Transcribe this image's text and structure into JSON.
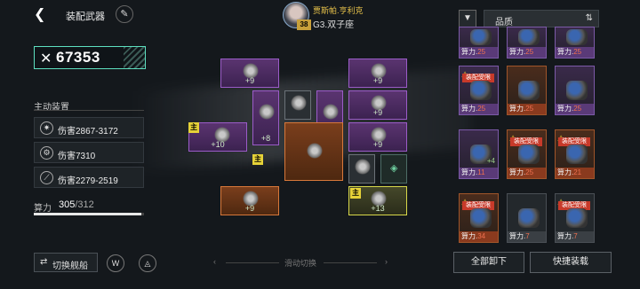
{
  "header": {
    "title": "装配武器",
    "pilot_name": "贾斯帕.亨利克",
    "pilot_ship": "G3.双子座",
    "pilot_level": "38"
  },
  "left": {
    "power_value": "67353",
    "active_equipment_label": "主动装置",
    "skills": [
      {
        "icon": "burst-icon",
        "text": "伤害2867-3172"
      },
      {
        "icon": "gear-burst-icon",
        "text": "伤害7310"
      },
      {
        "icon": "claw-icon",
        "text": "伤害2279-2519"
      }
    ],
    "capacity_label": "算力",
    "capacity_used": "305",
    "capacity_max": "/312",
    "capacity_fraction": 0.9776,
    "swap_ship_label": "切换舰船"
  },
  "swipe": {
    "label": "滑动切换"
  },
  "grid": {
    "slots": [
      {
        "label": "+9"
      },
      {
        "label": "+9"
      },
      {
        "label": "+9"
      },
      {
        "label": "+9"
      },
      {
        "label": "+10"
      },
      {
        "label": "+8"
      },
      {
        "label": "+9"
      },
      {
        "label": "+9"
      },
      {
        "label": "+9"
      },
      {
        "label": "+13"
      }
    ],
    "main_marker": "主"
  },
  "panel": {
    "sort_label": "品质",
    "power_prefix": "算力.",
    "lock_label": "装配受限",
    "cards": [
      {
        "power": "25",
        "plus": "",
        "locked": false
      },
      {
        "power": "25",
        "plus": "",
        "locked": false
      },
      {
        "power": "25",
        "plus": "",
        "locked": false
      },
      {
        "power": "25",
        "plus": "",
        "locked": true
      },
      {
        "power": "25",
        "plus": "",
        "locked": false
      },
      {
        "power": "25",
        "plus": "",
        "locked": false
      },
      {
        "power": "11",
        "plus": "+4",
        "locked": false
      },
      {
        "power": "25",
        "plus": "",
        "locked": true
      },
      {
        "power": "21",
        "plus": "",
        "locked": true
      },
      {
        "power": "9",
        "plus": "",
        "locked": true
      },
      {
        "power": "34",
        "plus": "",
        "locked": true
      },
      {
        "power": "7",
        "plus": "",
        "locked": false
      },
      {
        "power": "7",
        "plus": "",
        "locked": true
      }
    ],
    "unequip_all_label": "全部卸下",
    "quick_equip_label": "快捷装载"
  }
}
